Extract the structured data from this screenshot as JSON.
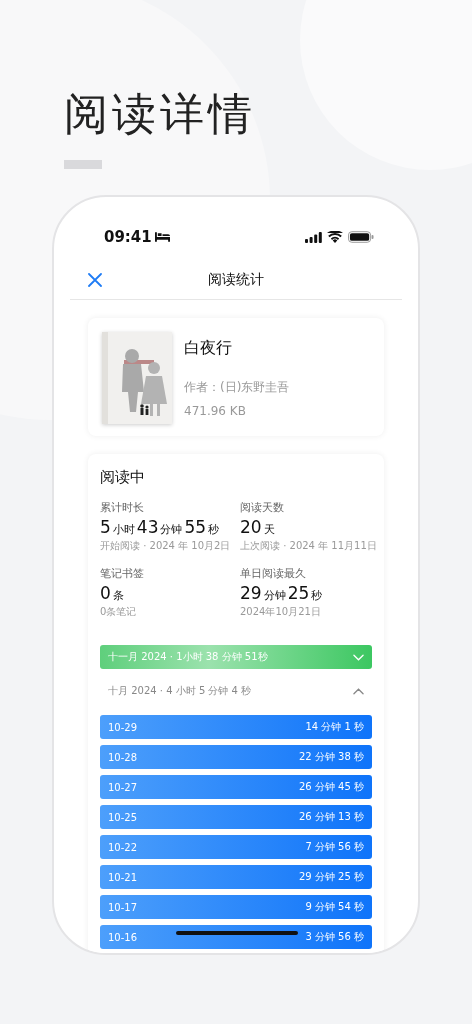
{
  "heading": "阅读详情",
  "status_bar": {
    "time": "09:41"
  },
  "nav": {
    "title": "阅读统计"
  },
  "book": {
    "title": "白夜行",
    "author": "作者：(日)东野圭吾",
    "size": "471.96 KB"
  },
  "stats": {
    "status": "阅读中",
    "items": [
      {
        "label": "累计时长",
        "value": [
          {
            "kind": "number",
            "text": "5"
          },
          {
            "kind": "unit",
            "text": "小时"
          },
          {
            "kind": "number",
            "text": "43"
          },
          {
            "kind": "unit",
            "text": "分钟"
          },
          {
            "kind": "number",
            "text": "55"
          },
          {
            "kind": "unit",
            "text": "秒"
          }
        ],
        "note": "开始阅读 · 2024 年 10月2日"
      },
      {
        "label": "阅读天数",
        "value": [
          {
            "kind": "number",
            "text": "20"
          },
          {
            "kind": "unit",
            "text": "天"
          }
        ],
        "note": "上次阅读 · 2024 年 11月11日"
      },
      {
        "label": "笔记书签",
        "value": [
          {
            "kind": "number",
            "text": "0"
          },
          {
            "kind": "unit",
            "text": "条"
          }
        ],
        "note": "0条笔记"
      },
      {
        "label": "单日阅读最久",
        "value": [
          {
            "kind": "number",
            "text": "29"
          },
          {
            "kind": "unit",
            "text": "分钟"
          },
          {
            "kind": "number",
            "text": "25"
          },
          {
            "kind": "unit",
            "text": "秒"
          }
        ],
        "note": "2024年10月21日"
      }
    ]
  },
  "months": [
    {
      "label": "十一月 2024 · 1小时 38 分钟 51秒",
      "expanded": false
    },
    {
      "label": "十月 2024 · 4 小时 5 分钟 4 秒",
      "expanded": true,
      "days": [
        {
          "date": "10-29",
          "duration": "14 分钟 1 秒"
        },
        {
          "date": "10-28",
          "duration": "22 分钟 38 秒"
        },
        {
          "date": "10-27",
          "duration": "26 分钟 45 秒"
        },
        {
          "date": "10-25",
          "duration": "26 分钟 13 秒"
        },
        {
          "date": "10-22",
          "duration": "7 分钟 56 秒"
        },
        {
          "date": "10-21",
          "duration": "29 分钟 25 秒"
        },
        {
          "date": "10-17",
          "duration": "9 分钟 54 秒"
        },
        {
          "date": "10-16",
          "duration": "3 分钟 56 秒"
        }
      ]
    }
  ]
}
